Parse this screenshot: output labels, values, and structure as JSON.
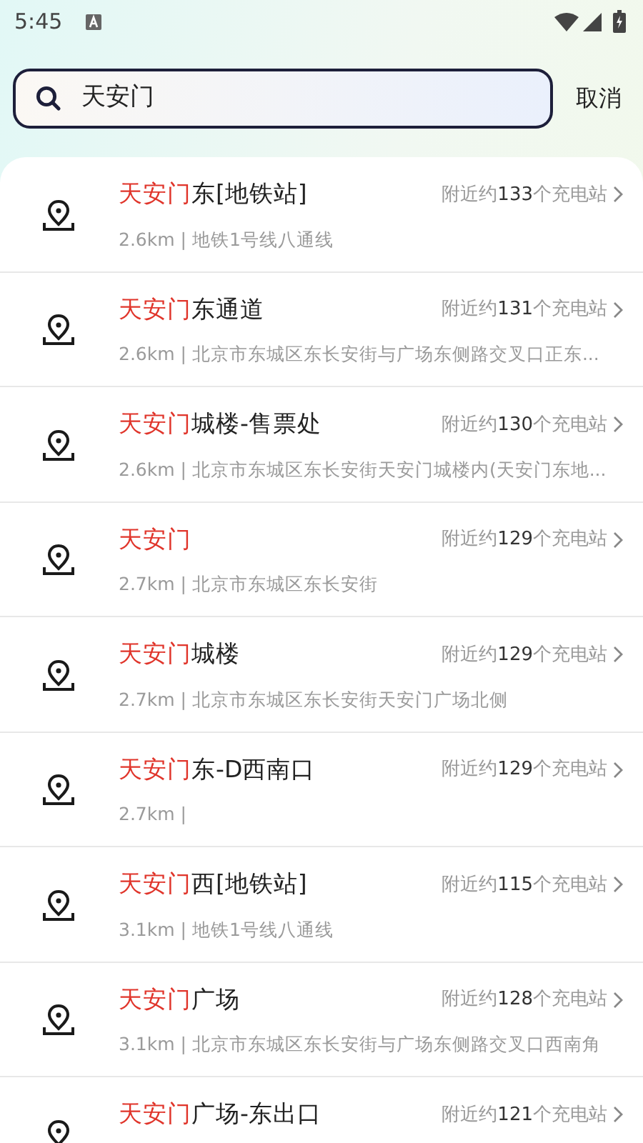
{
  "status_bar": {
    "time": "5:45"
  },
  "search": {
    "value": "天安门",
    "cancel": "取消"
  },
  "results": [
    {
      "match": "天安门",
      "rest": "东[地铁站]",
      "nearby": {
        "before": "附近约",
        "number": "133",
        "after": "个充电站"
      },
      "detail": "2.6km | 地铁1号线八通线"
    },
    {
      "match": "天安门",
      "rest": "东通道",
      "nearby": {
        "before": "附近约",
        "number": "131",
        "after": "个充电站"
      },
      "detail": "2.6km | 北京市东城区东长安街与广场东侧路交叉口正东..."
    },
    {
      "match": "天安门",
      "rest": "城楼-售票处",
      "nearby": {
        "before": "附近约",
        "number": "130",
        "after": "个充电站"
      },
      "detail": "2.6km | 北京市东城区东长安街天安门城楼内(天安门东地..."
    },
    {
      "match": "天安门",
      "nearby": {
        "before": "附近约",
        "number": "129",
        "after": "个充电站"
      },
      "detail": "2.7km | 北京市东城区东长安街"
    },
    {
      "match": "天安门",
      "rest": "城楼",
      "nearby": {
        "before": "附近约",
        "number": "129",
        "after": "个充电站"
      },
      "detail": "2.7km | 北京市东城区东长安街天安门广场北侧"
    },
    {
      "match": "天安门",
      "rest": "东-D西南口",
      "nearby": {
        "before": "附近约",
        "number": "129",
        "after": "个充电站"
      },
      "detail": "2.7km |"
    },
    {
      "match": "天安门",
      "rest": "西[地铁站]",
      "nearby": {
        "before": "附近约",
        "number": "115",
        "after": "个充电站"
      },
      "detail": "3.1km | 地铁1号线八通线"
    },
    {
      "match": "天安门",
      "rest": "广场",
      "nearby": {
        "before": "附近约",
        "number": "128",
        "after": "个充电站"
      },
      "detail": "3.1km | 北京市东城区东长安街与广场东侧路交叉口西南角"
    },
    {
      "match": "天安门",
      "rest": "广场-东出口",
      "nearby": {
        "before": "附近约",
        "number": "121",
        "after": "个充电站"
      }
    }
  ]
}
